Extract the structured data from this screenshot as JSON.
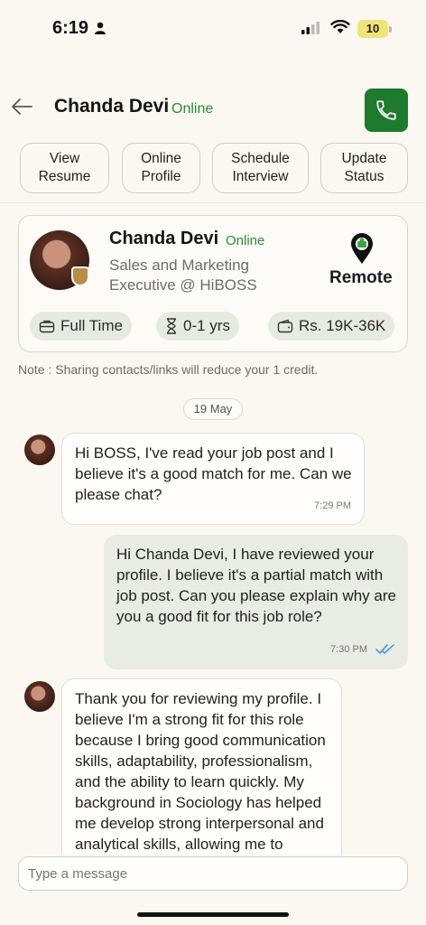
{
  "status_bar": {
    "time": "6:19",
    "battery": "10"
  },
  "header": {
    "name": "Chanda Devi",
    "status": "Online"
  },
  "actions": [
    {
      "label": "View\nResume"
    },
    {
      "label": "Online\nProfile"
    },
    {
      "label": "Schedule\nInterview"
    },
    {
      "label": "Update\nStatus"
    }
  ],
  "profile_card": {
    "name": "Chanda Devi",
    "status": "Online",
    "role": "Sales and Marketing Executive @ HiBOSS",
    "location": "Remote",
    "job_type": "Full Time",
    "experience": "0-1 yrs",
    "salary": "Rs. 19K-36K"
  },
  "note": "Note : Sharing contacts/links will reduce your 1 credit.",
  "date_separator": "19 May",
  "messages": [
    {
      "direction": "incoming",
      "text": "Hi BOSS, I've read your job post and I believe it's a good match for me. Can we please chat?",
      "time": "7:29 PM"
    },
    {
      "direction": "outgoing",
      "text": "Hi Chanda Devi, I have reviewed your profile. I believe it's a partial match with job post. Can you please explain why are you a good fit for this job role?",
      "time": "7:30 PM"
    },
    {
      "direction": "incoming",
      "text": "Thank you for reviewing my profile. I believe I'm a strong fit for this role because I bring good communication skills, adaptability, professionalism, and the ability to learn quickly. My background in Sociology has helped me develop strong interpersonal and analytical skills, allowing me to understand"
    }
  ],
  "composer": {
    "placeholder": "Type a message"
  },
  "colors": {
    "accent": "#1e7a2c",
    "online": "#2d8a3a",
    "outgoing_bubble": "#e8ece3",
    "read_ticks": "#3a8ee6"
  }
}
